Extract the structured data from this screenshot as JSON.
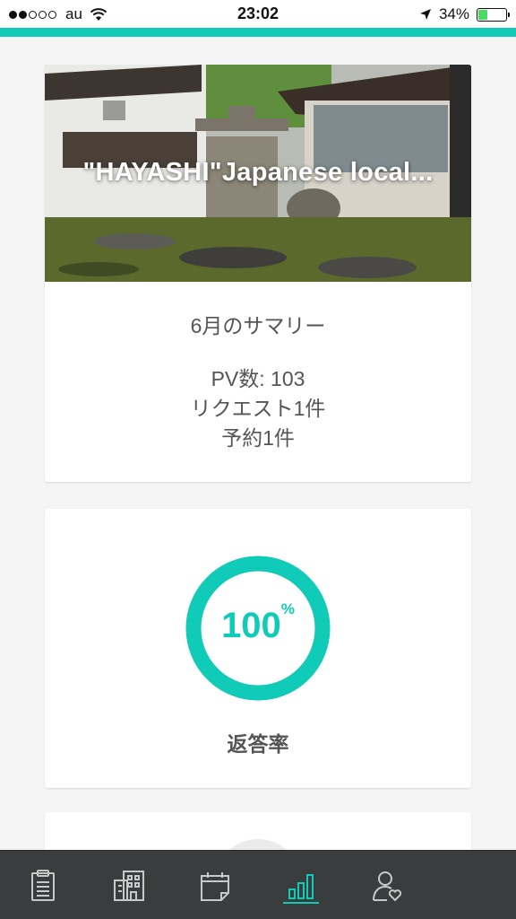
{
  "status_bar": {
    "carrier": "au",
    "time": "23:02",
    "battery_percent": "34%",
    "battery_level": 0.34,
    "signal_strength_dots": 2
  },
  "colors": {
    "accent": "#11cbb9",
    "tab_bar": "#3a3d3d",
    "icon": "#c8c8c8"
  },
  "summary_card": {
    "listing_title": "\"HAYASHI\"Japanese local...",
    "heading": "6月のサマリー",
    "pv": "PV数: 103",
    "requests": "リクエスト1件",
    "bookings": "予約1件"
  },
  "rate_card": {
    "value": "100",
    "unit": "%",
    "fraction": 1.0,
    "label": "返答率"
  },
  "tabs": [
    {
      "icon": "clipboard-icon",
      "active": false
    },
    {
      "icon": "building-icon",
      "active": false
    },
    {
      "icon": "calendar-icon",
      "active": false
    },
    {
      "icon": "bar-chart-icon",
      "active": true
    },
    {
      "icon": "user-heart-icon",
      "active": false
    }
  ]
}
